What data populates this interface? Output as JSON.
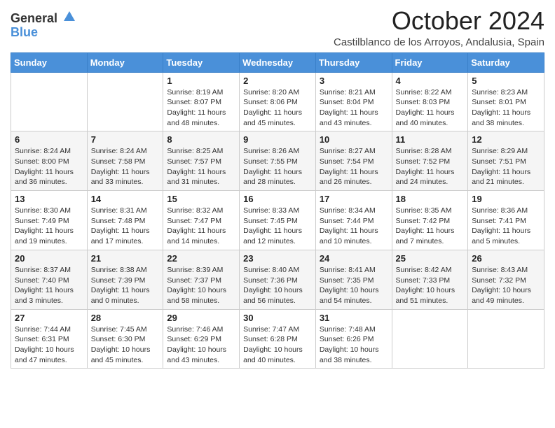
{
  "header": {
    "logo_general": "General",
    "logo_blue": "Blue",
    "month": "October 2024",
    "location": "Castilblanco de los Arroyos, Andalusia, Spain"
  },
  "days_of_week": [
    "Sunday",
    "Monday",
    "Tuesday",
    "Wednesday",
    "Thursday",
    "Friday",
    "Saturday"
  ],
  "weeks": [
    [
      {
        "day": "",
        "info": ""
      },
      {
        "day": "",
        "info": ""
      },
      {
        "day": "1",
        "info": "Sunrise: 8:19 AM\nSunset: 8:07 PM\nDaylight: 11 hours and 48 minutes."
      },
      {
        "day": "2",
        "info": "Sunrise: 8:20 AM\nSunset: 8:06 PM\nDaylight: 11 hours and 45 minutes."
      },
      {
        "day": "3",
        "info": "Sunrise: 8:21 AM\nSunset: 8:04 PM\nDaylight: 11 hours and 43 minutes."
      },
      {
        "day": "4",
        "info": "Sunrise: 8:22 AM\nSunset: 8:03 PM\nDaylight: 11 hours and 40 minutes."
      },
      {
        "day": "5",
        "info": "Sunrise: 8:23 AM\nSunset: 8:01 PM\nDaylight: 11 hours and 38 minutes."
      }
    ],
    [
      {
        "day": "6",
        "info": "Sunrise: 8:24 AM\nSunset: 8:00 PM\nDaylight: 11 hours and 36 minutes."
      },
      {
        "day": "7",
        "info": "Sunrise: 8:24 AM\nSunset: 7:58 PM\nDaylight: 11 hours and 33 minutes."
      },
      {
        "day": "8",
        "info": "Sunrise: 8:25 AM\nSunset: 7:57 PM\nDaylight: 11 hours and 31 minutes."
      },
      {
        "day": "9",
        "info": "Sunrise: 8:26 AM\nSunset: 7:55 PM\nDaylight: 11 hours and 28 minutes."
      },
      {
        "day": "10",
        "info": "Sunrise: 8:27 AM\nSunset: 7:54 PM\nDaylight: 11 hours and 26 minutes."
      },
      {
        "day": "11",
        "info": "Sunrise: 8:28 AM\nSunset: 7:52 PM\nDaylight: 11 hours and 24 minutes."
      },
      {
        "day": "12",
        "info": "Sunrise: 8:29 AM\nSunset: 7:51 PM\nDaylight: 11 hours and 21 minutes."
      }
    ],
    [
      {
        "day": "13",
        "info": "Sunrise: 8:30 AM\nSunset: 7:49 PM\nDaylight: 11 hours and 19 minutes."
      },
      {
        "day": "14",
        "info": "Sunrise: 8:31 AM\nSunset: 7:48 PM\nDaylight: 11 hours and 17 minutes."
      },
      {
        "day": "15",
        "info": "Sunrise: 8:32 AM\nSunset: 7:47 PM\nDaylight: 11 hours and 14 minutes."
      },
      {
        "day": "16",
        "info": "Sunrise: 8:33 AM\nSunset: 7:45 PM\nDaylight: 11 hours and 12 minutes."
      },
      {
        "day": "17",
        "info": "Sunrise: 8:34 AM\nSunset: 7:44 PM\nDaylight: 11 hours and 10 minutes."
      },
      {
        "day": "18",
        "info": "Sunrise: 8:35 AM\nSunset: 7:42 PM\nDaylight: 11 hours and 7 minutes."
      },
      {
        "day": "19",
        "info": "Sunrise: 8:36 AM\nSunset: 7:41 PM\nDaylight: 11 hours and 5 minutes."
      }
    ],
    [
      {
        "day": "20",
        "info": "Sunrise: 8:37 AM\nSunset: 7:40 PM\nDaylight: 11 hours and 3 minutes."
      },
      {
        "day": "21",
        "info": "Sunrise: 8:38 AM\nSunset: 7:39 PM\nDaylight: 11 hours and 0 minutes."
      },
      {
        "day": "22",
        "info": "Sunrise: 8:39 AM\nSunset: 7:37 PM\nDaylight: 10 hours and 58 minutes."
      },
      {
        "day": "23",
        "info": "Sunrise: 8:40 AM\nSunset: 7:36 PM\nDaylight: 10 hours and 56 minutes."
      },
      {
        "day": "24",
        "info": "Sunrise: 8:41 AM\nSunset: 7:35 PM\nDaylight: 10 hours and 54 minutes."
      },
      {
        "day": "25",
        "info": "Sunrise: 8:42 AM\nSunset: 7:33 PM\nDaylight: 10 hours and 51 minutes."
      },
      {
        "day": "26",
        "info": "Sunrise: 8:43 AM\nSunset: 7:32 PM\nDaylight: 10 hours and 49 minutes."
      }
    ],
    [
      {
        "day": "27",
        "info": "Sunrise: 7:44 AM\nSunset: 6:31 PM\nDaylight: 10 hours and 47 minutes."
      },
      {
        "day": "28",
        "info": "Sunrise: 7:45 AM\nSunset: 6:30 PM\nDaylight: 10 hours and 45 minutes."
      },
      {
        "day": "29",
        "info": "Sunrise: 7:46 AM\nSunset: 6:29 PM\nDaylight: 10 hours and 43 minutes."
      },
      {
        "day": "30",
        "info": "Sunrise: 7:47 AM\nSunset: 6:28 PM\nDaylight: 10 hours and 40 minutes."
      },
      {
        "day": "31",
        "info": "Sunrise: 7:48 AM\nSunset: 6:26 PM\nDaylight: 10 hours and 38 minutes."
      },
      {
        "day": "",
        "info": ""
      },
      {
        "day": "",
        "info": ""
      }
    ]
  ]
}
